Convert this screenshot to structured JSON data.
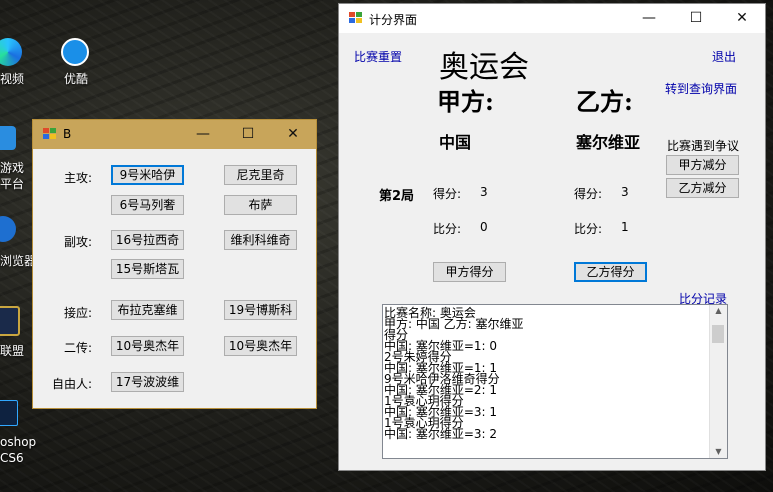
{
  "desktop": {
    "icons": [
      {
        "label": "视频"
      },
      {
        "label": "优酷"
      },
      {
        "label": "游戏平台"
      },
      {
        "label": "浏览器"
      },
      {
        "label": "联盟"
      },
      {
        "label": "oshop CS6"
      }
    ]
  },
  "windowB": {
    "title": "B",
    "controls": {
      "minimize": "—",
      "maximize": "☐",
      "close": "✕"
    },
    "positions": [
      {
        "label": "主攻:",
        "buttons": [
          "9号米哈伊",
          "尼克里奇",
          "6号马列奢",
          "布萨"
        ]
      },
      {
        "label": "副攻:",
        "buttons": [
          "16号拉西奇",
          "维利科维奇",
          "15号斯塔瓦"
        ]
      },
      {
        "label": "接应:",
        "buttons": [
          "布拉克塞维",
          "19号博斯科"
        ]
      },
      {
        "label": "二传:",
        "buttons": [
          "10号奥杰年",
          "10号奥杰年"
        ]
      },
      {
        "label": "自由人:",
        "buttons": [
          "17号波波维"
        ]
      }
    ]
  },
  "mainWindow": {
    "title": "计分界面",
    "controls": {
      "minimize": "—",
      "maximize": "☐",
      "close": "✕"
    },
    "reset_label": "比赛重置",
    "exit_label": "退出",
    "event_name": "奥运会",
    "query_label": "转到查询界面",
    "team_a_heading": "甲方:",
    "team_b_heading": "乙方:",
    "team_a_name": "中国",
    "team_b_name": "塞尔维亚",
    "dispute_label": "比赛遇到争议",
    "team_a_deduct_label": "甲方减分",
    "team_b_deduct_label": "乙方减分",
    "game_label": "第2局",
    "score_label": "得分:",
    "set_label": "比分:",
    "team_a_score": "3",
    "team_b_score": "3",
    "team_a_set": "0",
    "team_b_set": "1",
    "team_a_score_button": "甲方得分",
    "team_b_score_button": "乙方得分",
    "record_label": "比分记录",
    "log": [
      "比赛名称: 奥运会",
      "甲方: 中国   乙方: 塞尔维亚",
      "得分",
      "中国: 塞尔维亚=1: 0",
      "2号朱婷得分",
      "中国: 塞尔维亚=1: 1",
      "9号米哈伊洛维奇得分",
      "中国: 塞尔维亚=2: 1",
      "1号袁心玥得分",
      "中国: 塞尔维亚=3: 1",
      "1号袁心玥得分",
      "中国: 塞尔维亚=3: 2"
    ]
  }
}
